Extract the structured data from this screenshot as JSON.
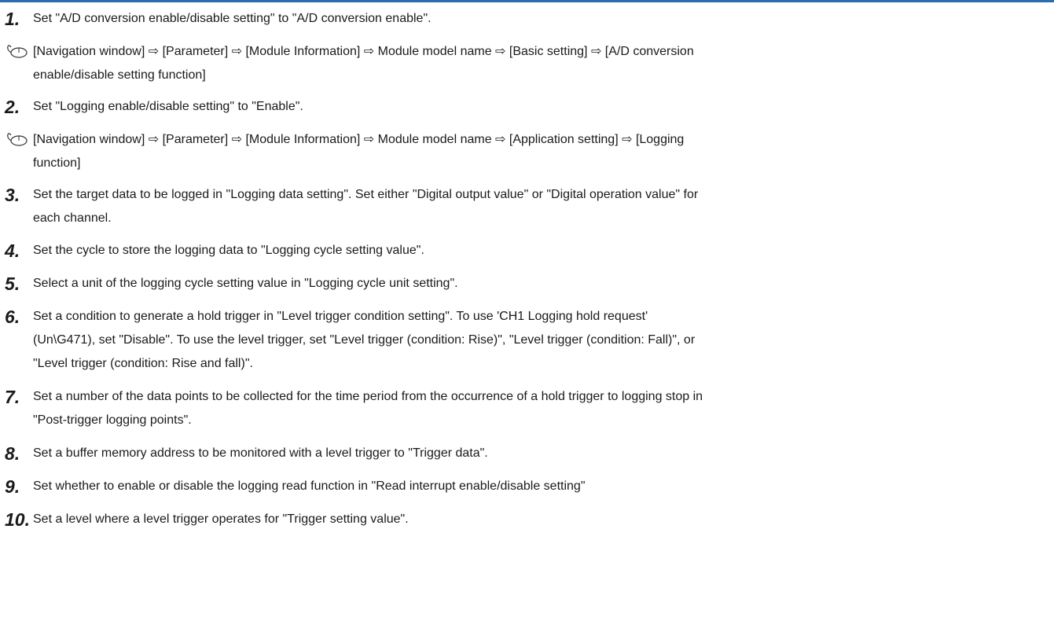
{
  "steps": [
    {
      "number": "1.",
      "text": "Set \"A/D conversion enable/disable setting\" to \"A/D conversion enable\"."
    },
    {
      "number": "2.",
      "text": "Set \"Logging enable/disable setting\" to \"Enable\"."
    },
    {
      "number": "3.",
      "line1": "Set the target data to be logged in \"Logging data setting\". Set either \"Digital output value\" or \"Digital operation value\" for",
      "line2": "each channel."
    },
    {
      "number": "4.",
      "text": "Set the cycle to store the logging data to \"Logging cycle setting value\"."
    },
    {
      "number": "5.",
      "text": "Select a unit of the logging cycle setting value in \"Logging cycle unit setting\"."
    },
    {
      "number": "6.",
      "line1": "Set a condition to generate a hold trigger in \"Level trigger condition setting\". To use 'CH1 Logging hold request'",
      "line2": "(Un\\G471), set \"Disable\". To use the level trigger, set \"Level trigger (condition: Rise)\", \"Level trigger (condition: Fall)\", or",
      "line3": "\"Level trigger (condition: Rise and fall)\"."
    },
    {
      "number": "7.",
      "line1": "Set a number of the data points to be collected for the time period from the occurrence of a hold trigger to logging stop in",
      "line2": "\"Post-trigger logging points\"."
    },
    {
      "number": "8.",
      "text": "Set a buffer memory address to be monitored with a level trigger to \"Trigger data\"."
    },
    {
      "number": "9.",
      "text": "Set whether to enable or disable the logging read function in \"Read interrupt enable/disable setting\""
    },
    {
      "number": "10.",
      "text": "Set a level where a level trigger operates for \"Trigger setting value\"."
    }
  ],
  "nav_paths": [
    {
      "line1": "[Navigation window] ⇨ [Parameter] ⇨ [Module Information] ⇨ Module model name ⇨ [Basic setting] ⇨ [A/D conversion",
      "line2": "enable/disable setting function]",
      "icon": "mouse-icon"
    },
    {
      "line1": "[Navigation window] ⇨ [Parameter] ⇨ [Module Information] ⇨ Module model name ⇨ [Application setting] ⇨ [Logging",
      "line2": "function]",
      "icon": "mouse-icon"
    }
  ]
}
